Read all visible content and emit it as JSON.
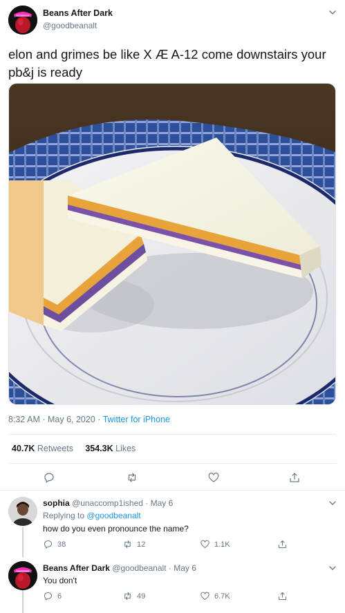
{
  "tweet": {
    "author_name": "Beans After Dark",
    "author_handle": "@goodbeanalt",
    "text": "elon and grimes be like X Æ A-12 come downstairs your pb&j is ready",
    "time": "8:32 AM",
    "date": "May 6, 2020",
    "source": "Twitter for iPhone",
    "retweets_count": "40.7K",
    "retweets_label": "Retweets",
    "likes_count": "354.3K",
    "likes_label": "Likes"
  },
  "replies": [
    {
      "name": "sophia",
      "handle": "@unaccomp1ished",
      "date": "May 6",
      "replying_prefix": "Replying to",
      "replying_to": "@goodbeanalt",
      "text": "how do you even pronounce the name?",
      "reply_count": "38",
      "retweet_count": "12",
      "like_count": "1.1K"
    },
    {
      "name": "Beans After Dark",
      "handle": "@goodbeanalt",
      "date": "May 6",
      "text": "You don't",
      "reply_count": "6",
      "retweet_count": "49",
      "like_count": "6.7K"
    }
  ],
  "colors": {
    "link": "#1b95e0",
    "secondary_text": "#657786",
    "divider": "#e6ecf0"
  },
  "icons": [
    "chevron-down-icon",
    "reply-icon",
    "retweet-icon",
    "like-icon",
    "share-icon"
  ]
}
